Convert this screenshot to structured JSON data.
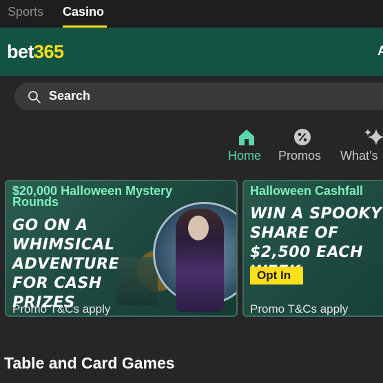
{
  "top_tabs": {
    "sports": "Sports",
    "casino": "Casino"
  },
  "header": {
    "logo_bet": "bet",
    "logo_num": "365",
    "right_clip": "A"
  },
  "search": {
    "label": "Search"
  },
  "nav": [
    {
      "label": "Home",
      "icon": "home-icon"
    },
    {
      "label": "Promos",
      "icon": "percent-icon"
    },
    {
      "label": "What's",
      "icon": "sparkle-icon"
    }
  ],
  "promos": [
    {
      "title": "$20,000 Halloween Mystery Rounds",
      "headline": "GO ON A WHIMSICAL ADVENTURE FOR CASH PRIZES",
      "terms": "Promo T&Cs apply"
    },
    {
      "title": "Halloween Cashfall",
      "headline": "WIN A SPOOKY SHARE OF $2,500 EACH WEEK",
      "cta": "Opt In",
      "terms": "Promo T&Cs apply"
    }
  ],
  "sections": {
    "table_games": "Table and Card Games"
  },
  "colors": {
    "brand_green": "#135341",
    "accent_yellow": "#ffdf1b",
    "active_nav": "#58d7af",
    "promo_title": "#7ff0bd"
  }
}
